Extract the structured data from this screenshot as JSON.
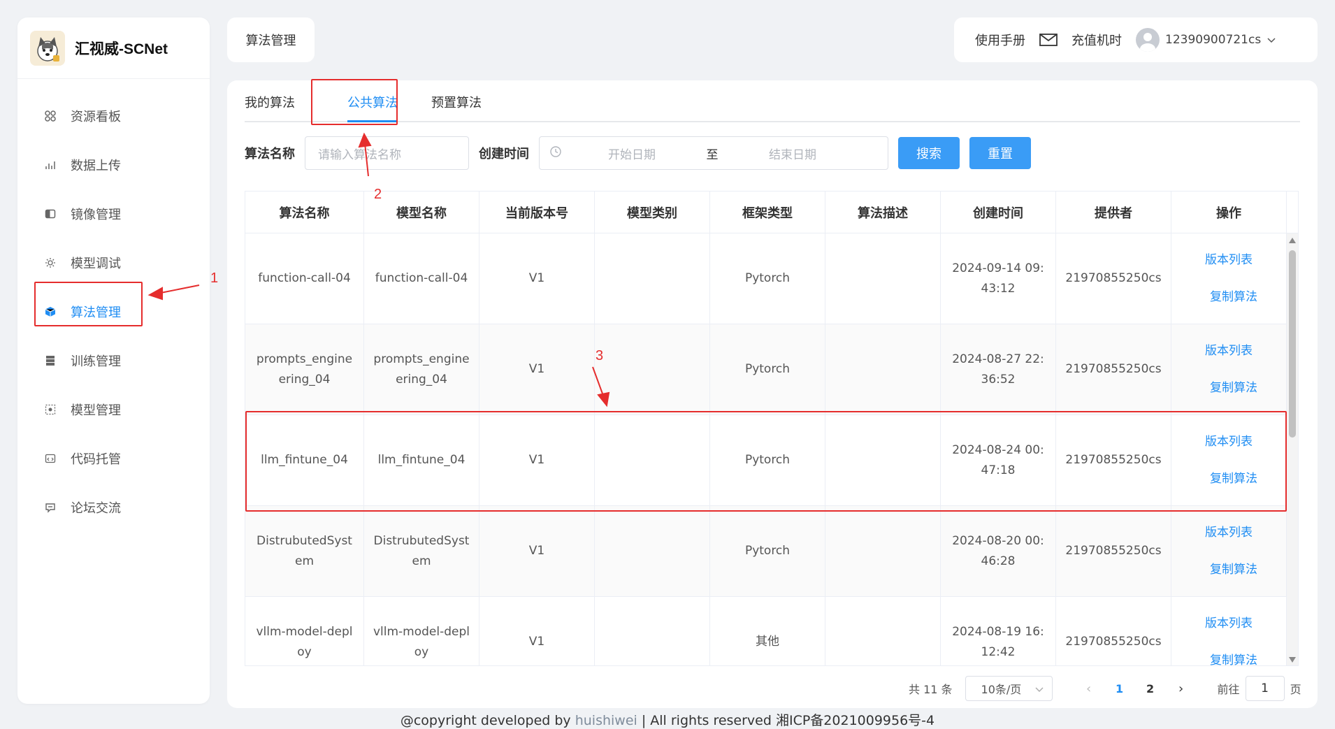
{
  "app": {
    "name": "汇视威-SCNet"
  },
  "sidebar": {
    "items": [
      {
        "label": "资源看板",
        "icon": "grid-icon"
      },
      {
        "label": "数据上传",
        "icon": "chart-icon"
      },
      {
        "label": "镜像管理",
        "icon": "image-icon"
      },
      {
        "label": "模型调试",
        "icon": "gear-icon"
      },
      {
        "label": "算法管理",
        "icon": "cube-icon",
        "active": true
      },
      {
        "label": "训练管理",
        "icon": "stack-icon"
      },
      {
        "label": "模型管理",
        "icon": "network-icon"
      },
      {
        "label": "代码托管",
        "icon": "code-icon"
      },
      {
        "label": "论坛交流",
        "icon": "chat-icon"
      }
    ]
  },
  "header": {
    "page_title": "算法管理",
    "manual": "使用手册",
    "recharge": "充值机时",
    "username": "12390900721cs"
  },
  "tabs": [
    "我的算法",
    "公共算法",
    "预置算法"
  ],
  "active_tab": 1,
  "filter": {
    "name_label": "算法名称",
    "name_placeholder": "请输入算法名称",
    "time_label": "创建时间",
    "start_placeholder": "开始日期",
    "separator": "至",
    "end_placeholder": "结束日期",
    "search_button": "搜索",
    "reset_button": "重置"
  },
  "table": {
    "headers": [
      "算法名称",
      "模型名称",
      "当前版本号",
      "模型类别",
      "框架类型",
      "算法描述",
      "创建时间",
      "提供者",
      "操作"
    ],
    "rows": [
      {
        "algo": "function-call-04",
        "model": "function-call-04",
        "version": "V1",
        "category": "",
        "framework": "Pytorch",
        "desc": "",
        "created": "2024-09-14 09:43:12",
        "provider": "21970855250cs"
      },
      {
        "algo": "prompts_engineering_04",
        "model": "prompts_engineering_04",
        "version": "V1",
        "category": "",
        "framework": "Pytorch",
        "desc": "",
        "created": "2024-08-27 22:36:52",
        "provider": "21970855250cs"
      },
      {
        "algo": "llm_fintune_04",
        "model": "llm_fintune_04",
        "version": "V1",
        "category": "",
        "framework": "Pytorch",
        "desc": "",
        "created": "2024-08-24 00:47:18",
        "provider": "21970855250cs"
      },
      {
        "algo": "DistrubutedSystem",
        "model": "DistrubutedSystem",
        "version": "V1",
        "category": "",
        "framework": "Pytorch",
        "desc": "",
        "created": "2024-08-20 00:46:28",
        "provider": "21970855250cs"
      },
      {
        "algo": "vllm-model-deploy",
        "model": "vllm-model-deploy",
        "version": "V1",
        "category": "",
        "framework": "其他",
        "desc": "",
        "created": "2024-08-19 16:12:42",
        "provider": "21970855250cs"
      }
    ],
    "op_versions": "版本列表",
    "op_copy": "复制算法"
  },
  "pagination": {
    "total": "共 11 条",
    "page_size": "10条/页",
    "pages": [
      "1",
      "2"
    ],
    "current": "1",
    "goto_label": "前往",
    "goto_value": "1",
    "page_suffix": "页"
  },
  "footer": {
    "prefix": "@copyright developed by ",
    "brand": "huishiwei",
    "suffix": " | All rights reserved 湘ICP备2021009956号-4"
  },
  "annotations": [
    "1",
    "2",
    "3"
  ],
  "colors": {
    "accent": "#1f8df3",
    "annotation": "#e52d2d"
  }
}
